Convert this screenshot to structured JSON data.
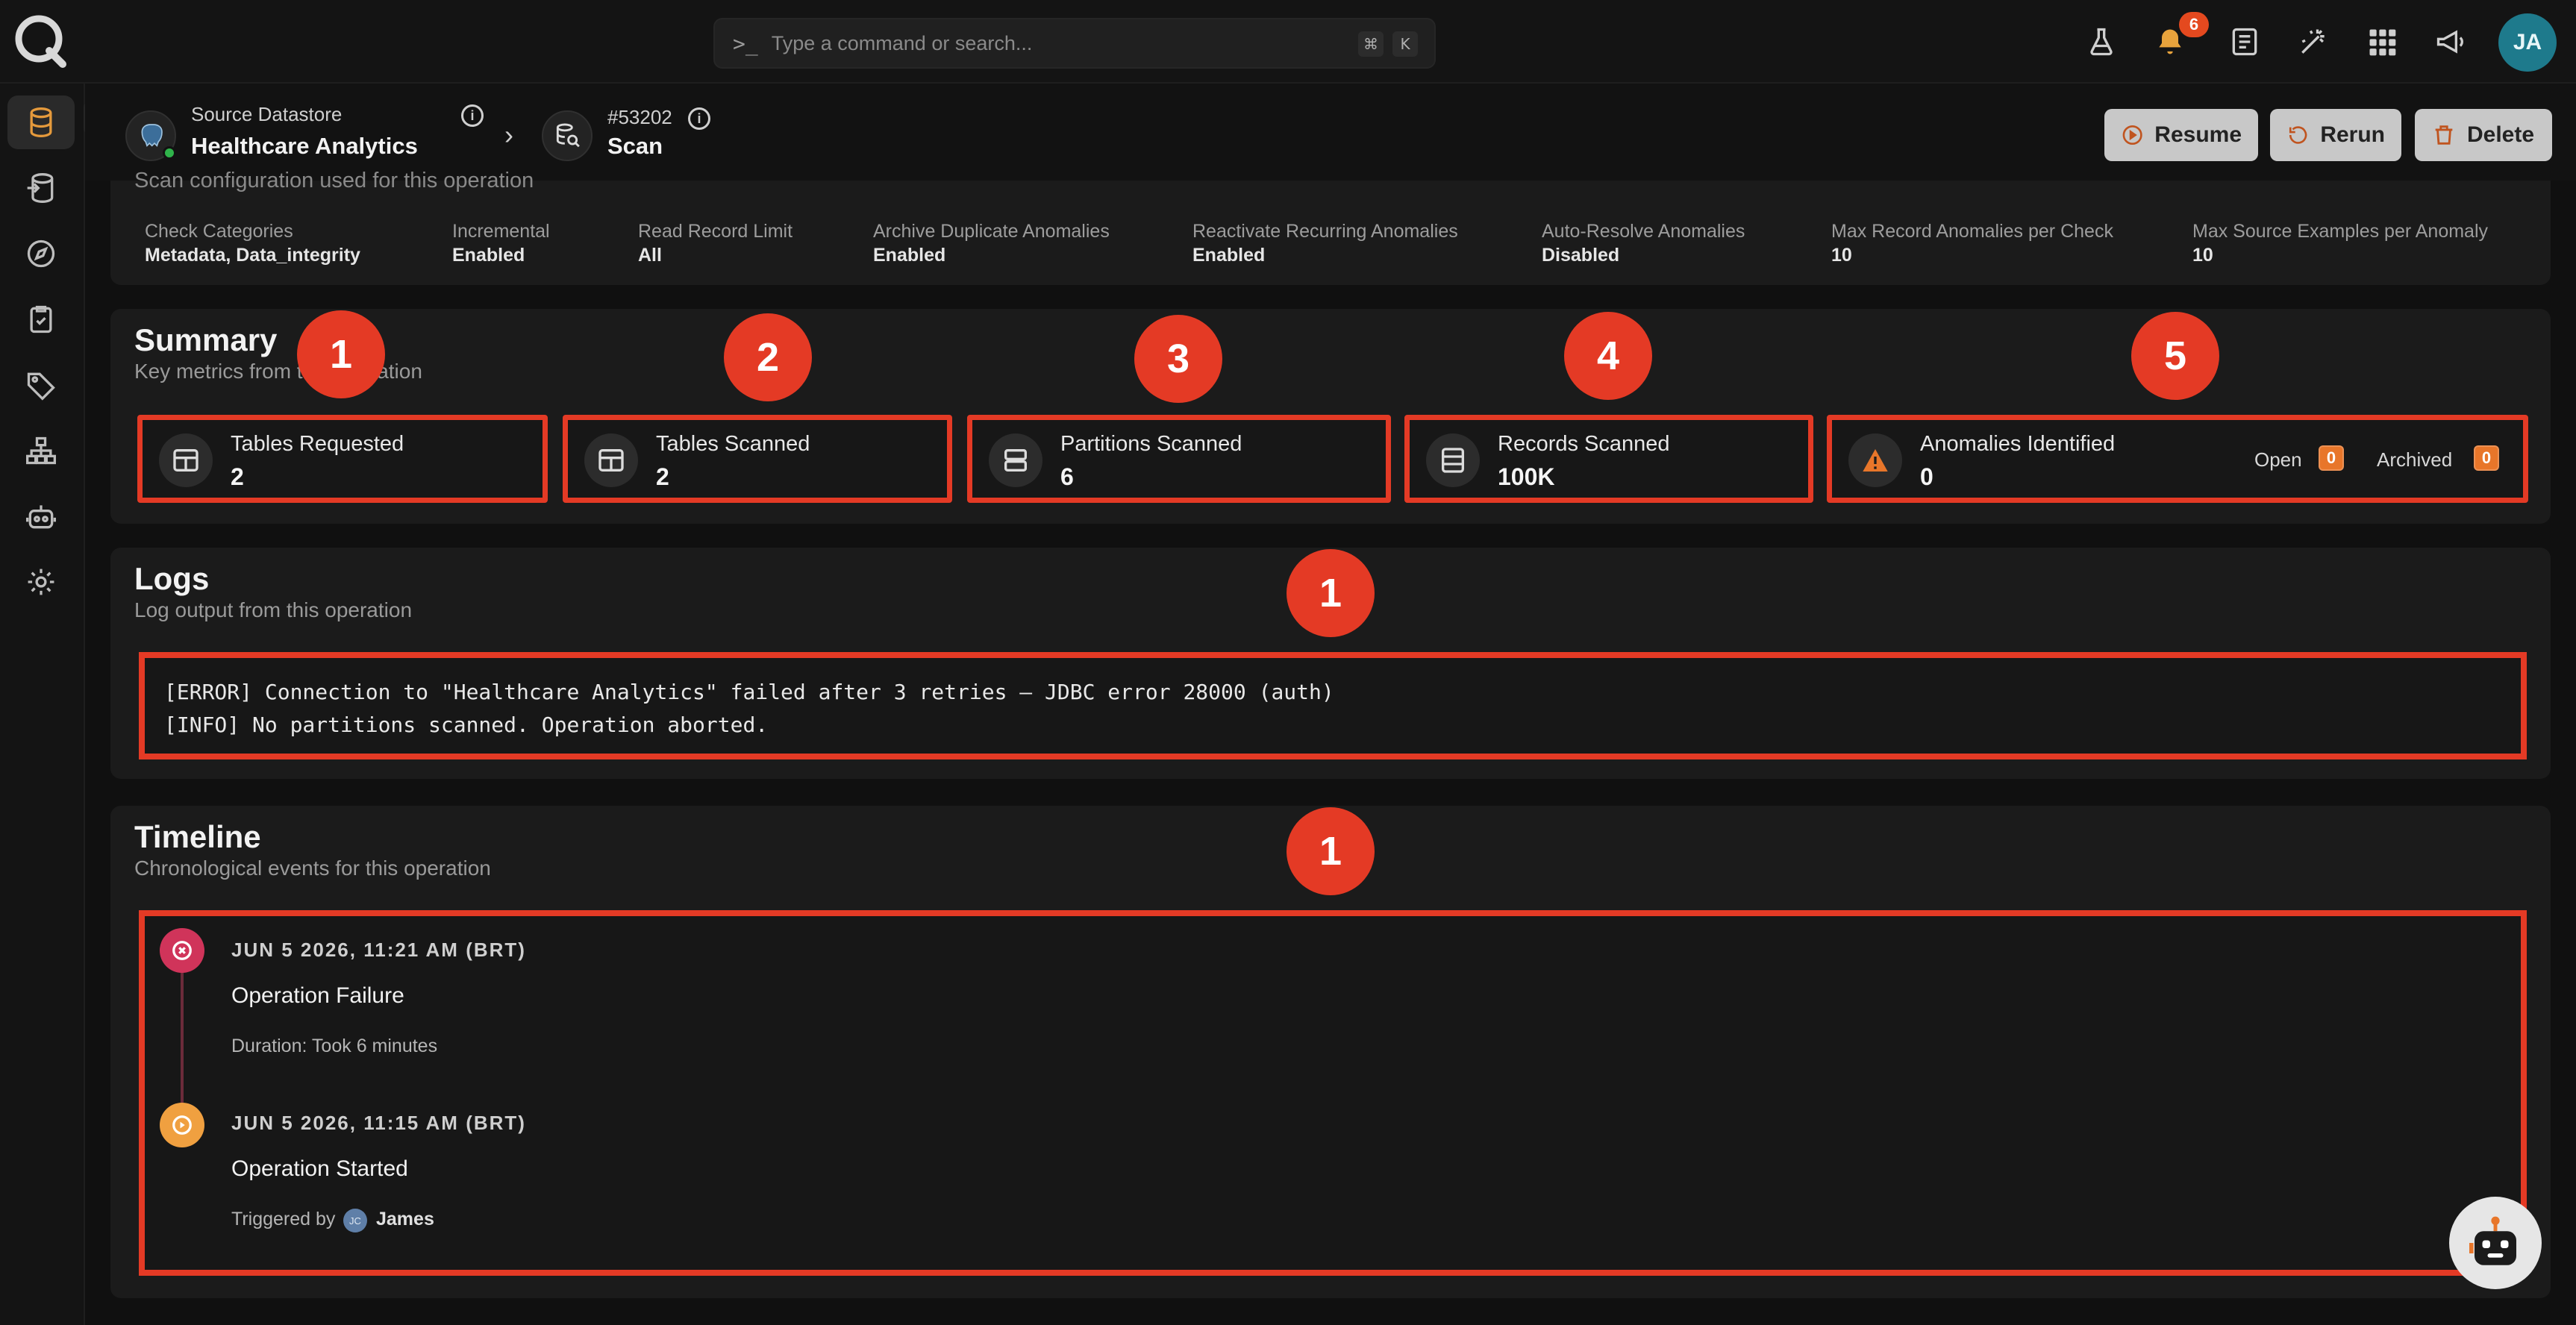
{
  "topbar": {
    "command_placeholder": "Type a command or search...",
    "shortcut_keys": [
      "⌘",
      "K"
    ],
    "notification_count": "6",
    "user_initials": "JA"
  },
  "breadcrumb": {
    "datastore_label": "Source Datastore",
    "datastore_name": "Healthcare Analytics",
    "operation_id": "#53202",
    "operation_type": "Scan"
  },
  "actions": {
    "resume": "Resume",
    "rerun": "Rerun",
    "delete": "Delete"
  },
  "config": {
    "caption": "Scan configuration used for this operation",
    "items": [
      {
        "label": "Check Categories",
        "value": "Metadata, Data_integrity"
      },
      {
        "label": "Incremental",
        "value": "Enabled"
      },
      {
        "label": "Read Record Limit",
        "value": "All"
      },
      {
        "label": "Archive Duplicate Anomalies",
        "value": "Enabled"
      },
      {
        "label": "Reactivate Recurring Anomalies",
        "value": "Enabled"
      },
      {
        "label": "Auto-Resolve Anomalies",
        "value": "Disabled"
      },
      {
        "label": "Max Record Anomalies per Check",
        "value": "10"
      },
      {
        "label": "Max Source Examples per Anomaly",
        "value": "10"
      }
    ]
  },
  "summary": {
    "title": "Summary",
    "subtitle": "Key metrics from this operation",
    "metrics": [
      {
        "label": "Tables Requested",
        "value": "2"
      },
      {
        "label": "Tables Scanned",
        "value": "2"
      },
      {
        "label": "Partitions Scanned",
        "value": "6"
      },
      {
        "label": "Records Scanned",
        "value": "100K"
      },
      {
        "label": "Anomalies Identified",
        "value": "0"
      }
    ],
    "open_label": "Open",
    "open_count": "0",
    "archived_label": "Archived",
    "archived_count": "0"
  },
  "markers": {
    "summary": [
      "1",
      "2",
      "3",
      "4",
      "5"
    ],
    "logs": "1",
    "timeline": "1"
  },
  "logs": {
    "title": "Logs",
    "subtitle": "Log output from this operation",
    "lines": [
      "[ERROR] Connection to \"Healthcare Analytics\" failed after 3 retries — JDBC error 28000 (auth)",
      "[INFO] No partitions scanned. Operation aborted."
    ]
  },
  "timeline": {
    "title": "Timeline",
    "subtitle": "Chronological events for this operation",
    "events": [
      {
        "date": "JUN 5 2026, 11:21 AM (BRT)",
        "title": "Operation Failure",
        "meta": "Duration: Took 6 minutes"
      },
      {
        "date": "JUN 5 2026, 11:15 AM (BRT)",
        "title": "Operation Started",
        "meta_label": "Triggered by",
        "user_initials": "JC",
        "user_name": "James"
      }
    ]
  },
  "colors": {
    "accent": "#e43a25",
    "warning": "#e8762a",
    "failure": "#d0345a",
    "started": "#f0a040"
  }
}
